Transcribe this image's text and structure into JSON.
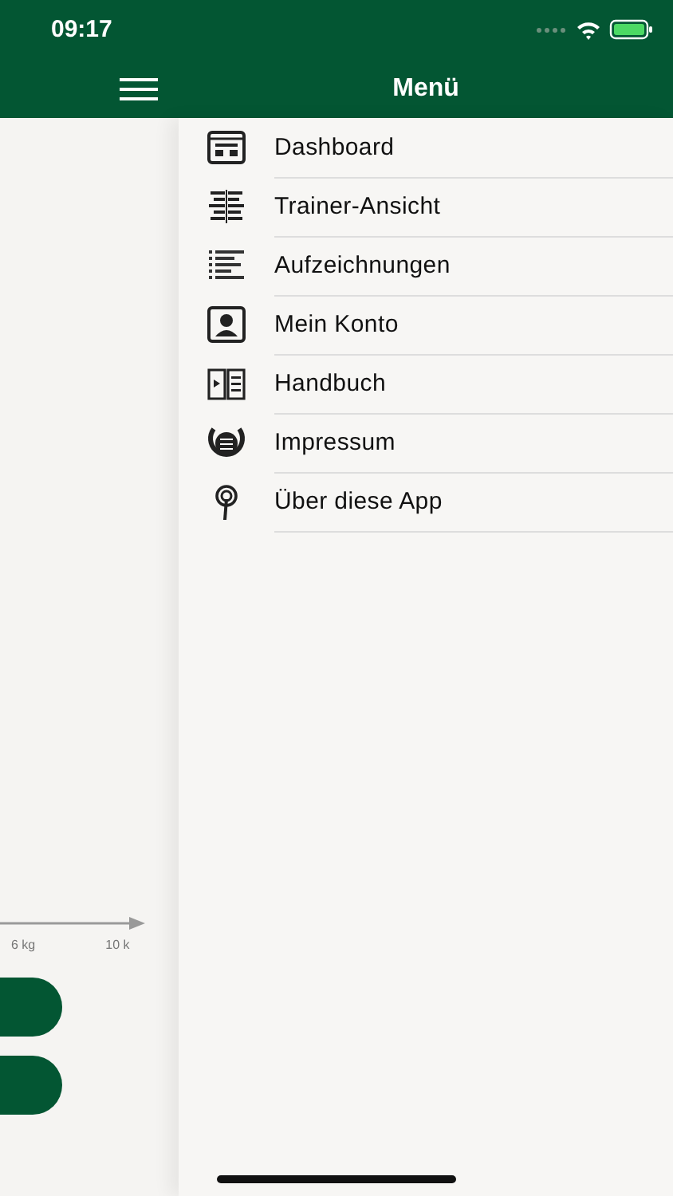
{
  "status_bar": {
    "time": "09:17"
  },
  "nav_bar": {
    "title": "Menü"
  },
  "background": {
    "axis_labels": [
      "6 kg",
      "10 k"
    ],
    "buttons": [
      {
        "kind": "pill"
      },
      {
        "kind": "pill"
      }
    ]
  },
  "menu": {
    "items": [
      {
        "label": "Dashboard",
        "kind": "dashboard"
      },
      {
        "label": "Trainer-Ansicht",
        "kind": "trainer"
      },
      {
        "label": "Aufzeichnungen",
        "kind": "records"
      },
      {
        "label": "Mein Konto",
        "kind": "account"
      },
      {
        "label": "Handbuch",
        "kind": "manual"
      },
      {
        "label": "Impressum",
        "kind": "imprint"
      },
      {
        "label": "Über diese App",
        "kind": "about"
      }
    ]
  }
}
